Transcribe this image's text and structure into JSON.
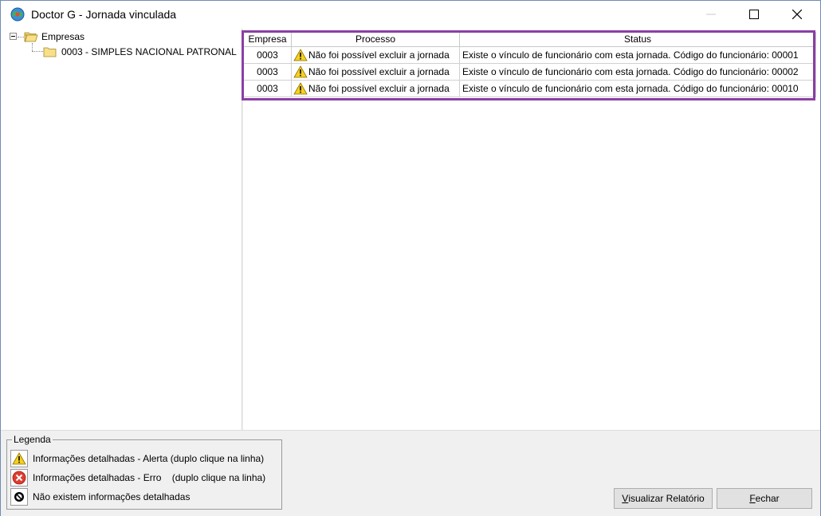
{
  "window": {
    "title": "Doctor G - Jornada vinculada",
    "icon": "app-globe-icon"
  },
  "tree": {
    "root_label": "Empresas",
    "child_label": "0003  - SIMPLES NACIONAL PATRONAL"
  },
  "grid": {
    "headers": [
      "Empresa",
      "Processo",
      "Status"
    ],
    "rows": [
      {
        "empresa": "0003",
        "processo": "Não foi possível excluir a jornada",
        "status": "Existe o vínculo de funcionário com esta jornada. Código do funcionário: 00001"
      },
      {
        "empresa": "0003",
        "processo": "Não foi possível excluir a jornada",
        "status": "Existe o vínculo de funcionário com esta jornada. Código do funcionário: 00002"
      },
      {
        "empresa": "0003",
        "processo": "Não foi possível excluir a jornada",
        "status": "Existe o vínculo de funcionário com esta jornada. Código do funcionário: 00010"
      }
    ],
    "highlight_color": "#8a3fa4"
  },
  "legend": {
    "title": "Legenda",
    "items": [
      {
        "icon": "warning-icon",
        "text": "Informações detalhadas - Alerta (duplo clique na linha)"
      },
      {
        "icon": "error-icon",
        "text": "Informações detalhadas - Erro    (duplo clique na linha)"
      },
      {
        "icon": "no-info-icon",
        "text": "Não existem informações detalhadas"
      }
    ]
  },
  "buttons": {
    "report": {
      "mnemonic": "V",
      "rest": "isualizar Relatório"
    },
    "close": {
      "mnemonic": "F",
      "rest": "echar"
    }
  }
}
